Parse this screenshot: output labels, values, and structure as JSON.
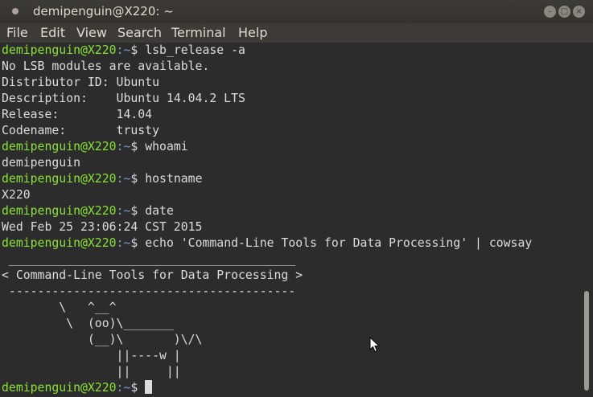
{
  "window": {
    "title": "demipenguin@X220: ~"
  },
  "menubar": {
    "items": [
      "File",
      "Edit",
      "View",
      "Search",
      "Terminal",
      "Help"
    ]
  },
  "prompt": {
    "user_host": "demipenguin@X220",
    "path": ":~",
    "symbol": "$"
  },
  "terminal": {
    "commands": {
      "lsb": "lsb_release -a",
      "whoami": "whoami",
      "hostname": "hostname",
      "date": "date",
      "cowsay": "echo 'Command-Line Tools for Data Processing' | cowsay"
    },
    "output": {
      "lsb_1": "No LSB modules are available.",
      "lsb_2": "Distributor ID:\tUbuntu",
      "lsb_3": "Description:\tUbuntu 14.04.2 LTS",
      "lsb_4": "Release:\t14.04",
      "lsb_5": "Codename:\ttrusty",
      "whoami": "demipenguin",
      "hostname": "X220",
      "date": "Wed Feb 25 23:06:24 CST 2015"
    },
    "cowsay": [
      " ________________________________________",
      "< Command-Line Tools for Data Processing >",
      " ----------------------------------------",
      "        \\   ^__^",
      "         \\  (oo)\\_______",
      "            (__)\\       )\\/\\",
      "                ||----w |",
      "                ||     ||"
    ]
  }
}
